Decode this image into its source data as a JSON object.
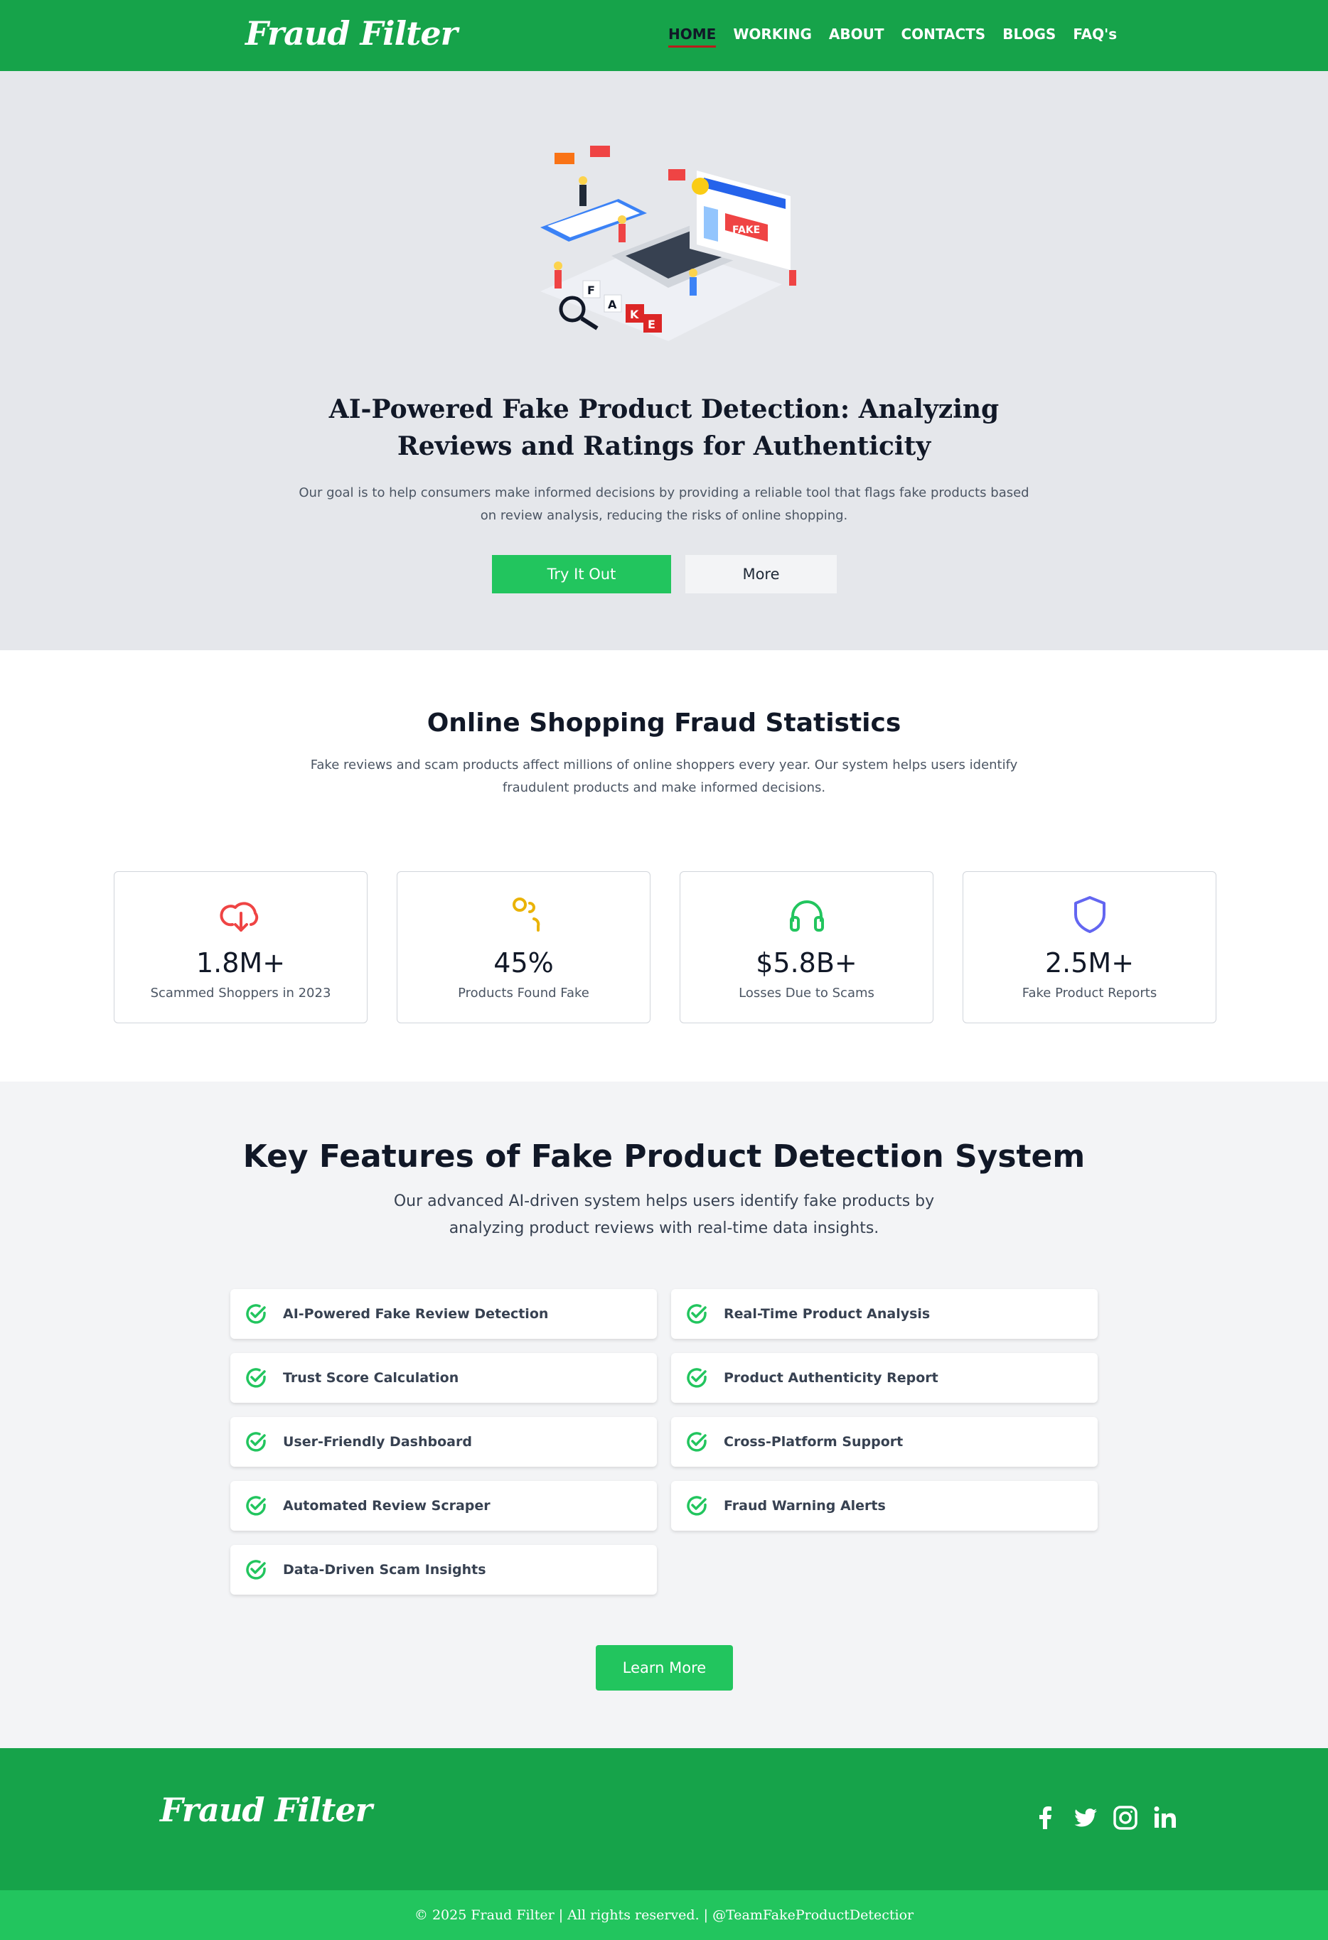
{
  "brand": {
    "name": "Fraud Filter"
  },
  "nav": {
    "items": [
      {
        "label": "HOME",
        "active": true
      },
      {
        "label": "WORKING"
      },
      {
        "label": "ABOUT"
      },
      {
        "label": "CONTACTS"
      },
      {
        "label": "BLOGS"
      },
      {
        "label": "FAQ's"
      }
    ]
  },
  "hero": {
    "title_line1": "AI-Powered Fake Product Detection: Analyzing",
    "title_line2": "Reviews and Ratings for Authenticity",
    "desc_line1": "Our goal is to help consumers make informed decisions by providing a reliable tool that flags fake products based",
    "desc_line2": "on review analysis, reducing the risks of online shopping.",
    "primary_button": "Try It Out",
    "secondary_button": "More",
    "illustration": {
      "badge_text": "FAKE",
      "letters": [
        "F",
        "A",
        "K",
        "E"
      ]
    }
  },
  "stats": {
    "title": "Online Shopping Fraud Statistics",
    "desc_line1": "Fake reviews and scam products affect millions of online shoppers every year. Our system helps users identify",
    "desc_line2": "fraudulent products and make informed decisions.",
    "cards": [
      {
        "icon": "cloud-download-icon",
        "color": "#ef4444",
        "value": "1.8M+",
        "label": "Scammed Shoppers in 2023"
      },
      {
        "icon": "users-icon",
        "color": "#eab308",
        "value": "45%",
        "label": "Products Found Fake"
      },
      {
        "icon": "headphones-icon",
        "color": "#22c55e",
        "value": "$5.8B+",
        "label": "Losses Due to Scams"
      },
      {
        "icon": "shield-icon",
        "color": "#6366f1",
        "value": "2.5M+",
        "label": "Fake Product Reports"
      }
    ]
  },
  "features": {
    "title": "Key Features of Fake Product Detection System",
    "desc_line1": "Our advanced AI-driven system helps users identify fake products by",
    "desc_line2": "analyzing product reviews with real-time data insights.",
    "items": [
      "AI-Powered Fake Review Detection",
      "Real-Time Product Analysis",
      "Trust Score Calculation",
      "Product Authenticity Report",
      "User-Friendly Dashboard",
      "Cross-Platform Support",
      "Automated Review Scraper",
      "Fraud Warning Alerts",
      "Data-Driven Scam Insights"
    ],
    "button": "Learn More"
  },
  "footer": {
    "socials": [
      "facebook-icon",
      "twitter-icon",
      "instagram-icon",
      "linkedin-icon"
    ],
    "copyright": "© 2025 Fraud Filter | All rights reserved. | @TeamFakeProductDetectior"
  },
  "colors": {
    "nav_bg": "#16a34a",
    "accent": "#22c55e",
    "hero_bg": "#e5e7eb",
    "features_bg": "#f3f4f6",
    "active_underline": "#b91c1c"
  }
}
